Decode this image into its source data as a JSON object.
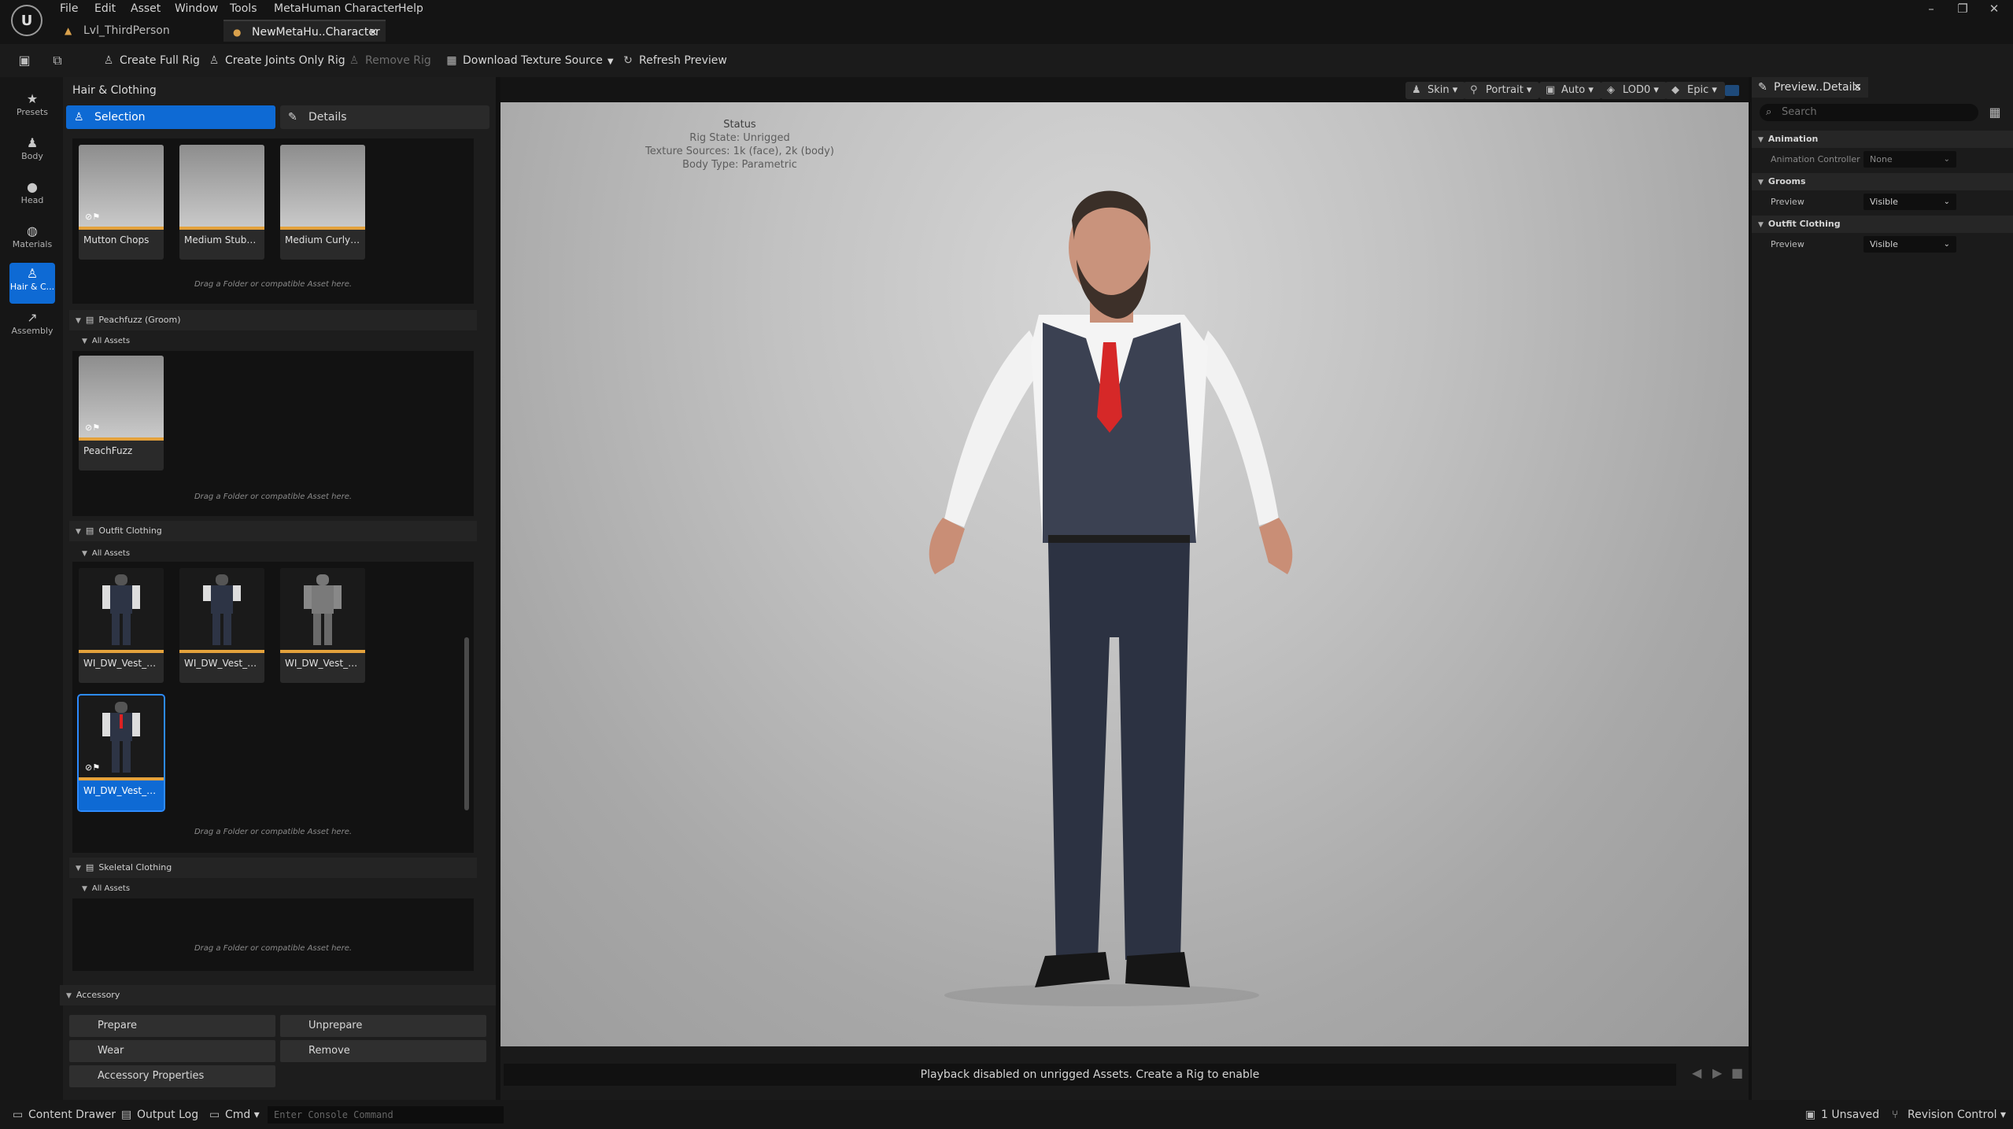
{
  "menu": [
    "File",
    "Edit",
    "Asset",
    "Window",
    "Tools",
    "MetaHuman Character",
    "Help"
  ],
  "tabs": [
    {
      "label": "Lvl_ThirdPerson"
    },
    {
      "label": "NewMetaHu..Character •",
      "close": "×"
    }
  ],
  "toolbar": {
    "create_full_rig": "Create Full Rig",
    "create_joints_only_rig": "Create Joints Only Rig",
    "remove_rig": "Remove Rig",
    "download_texture_source": "Download Texture Source",
    "refresh_preview": "Refresh Preview"
  },
  "left_strip": [
    {
      "label": "Presets",
      "icon": "star-icon"
    },
    {
      "label": "Body",
      "icon": "body-icon"
    },
    {
      "label": "Head",
      "icon": "head-icon"
    },
    {
      "label": "Materials",
      "icon": "materials-icon"
    },
    {
      "label": "Hair & C...",
      "icon": "hair-icon",
      "active": true
    },
    {
      "label": "Assembly",
      "icon": "assembly-icon"
    }
  ],
  "panel": {
    "title": "Hair & Clothing",
    "tab_selection": "Selection",
    "tab_details": "Details"
  },
  "beards": [
    "Mutton Chops",
    "Medium Stubble...",
    "Medium Curly Be..."
  ],
  "drop_hint": "Drag a Folder or compatible Asset here.",
  "all_assets": "All Assets",
  "peachfuzz": {
    "section": "Peachfuzz (Groom)",
    "item": "PeachFuzz"
  },
  "outfit": {
    "section": "Outfit Clothing",
    "items": [
      "WI_DW_Vest_Outfit",
      "WI_DW_Vest_Roll...",
      "WI_DW_Vest_Tie...",
      "WI_DW_Vest_Tie..."
    ]
  },
  "skeletal": {
    "section": "Skeletal Clothing"
  },
  "accessory": {
    "section": "Accessory",
    "prepare": "Prepare",
    "unprepare": "Unprepare",
    "wear": "Wear",
    "remove": "Remove",
    "properties": "Accessory Properties"
  },
  "viewport": {
    "buttons": [
      "Skin",
      "Portrait",
      "Auto",
      "LOD0",
      "Epic"
    ],
    "status_title": "Status",
    "status_lines": [
      "Rig State: Unrigged",
      "Texture Sources: 1k (face), 2k (body)",
      "Body Type: Parametric"
    ],
    "playback_msg": "Playback disabled on unrigged Assets. Create a Rig to enable"
  },
  "details": {
    "tab": "Preview..Details",
    "search_placeholder": "Search",
    "animation_section": "Animation",
    "animation_controller_label": "Animation Controller",
    "animation_controller_value": "None",
    "grooms_section": "Grooms",
    "grooms_preview_label": "Preview",
    "grooms_preview_value": "Visible",
    "outfit_section": "Outfit Clothing",
    "outfit_preview_label": "Preview",
    "outfit_preview_value": "Visible"
  },
  "bottom": {
    "content_drawer": "Content Drawer",
    "output_log": "Output Log",
    "cmd": "Cmd",
    "console_placeholder": "Enter Console Command",
    "unsaved": "1 Unsaved",
    "revision_control": "Revision Control"
  },
  "colors": {
    "accent": "#0e6ad4",
    "asset_bar": "#e4a23c"
  }
}
